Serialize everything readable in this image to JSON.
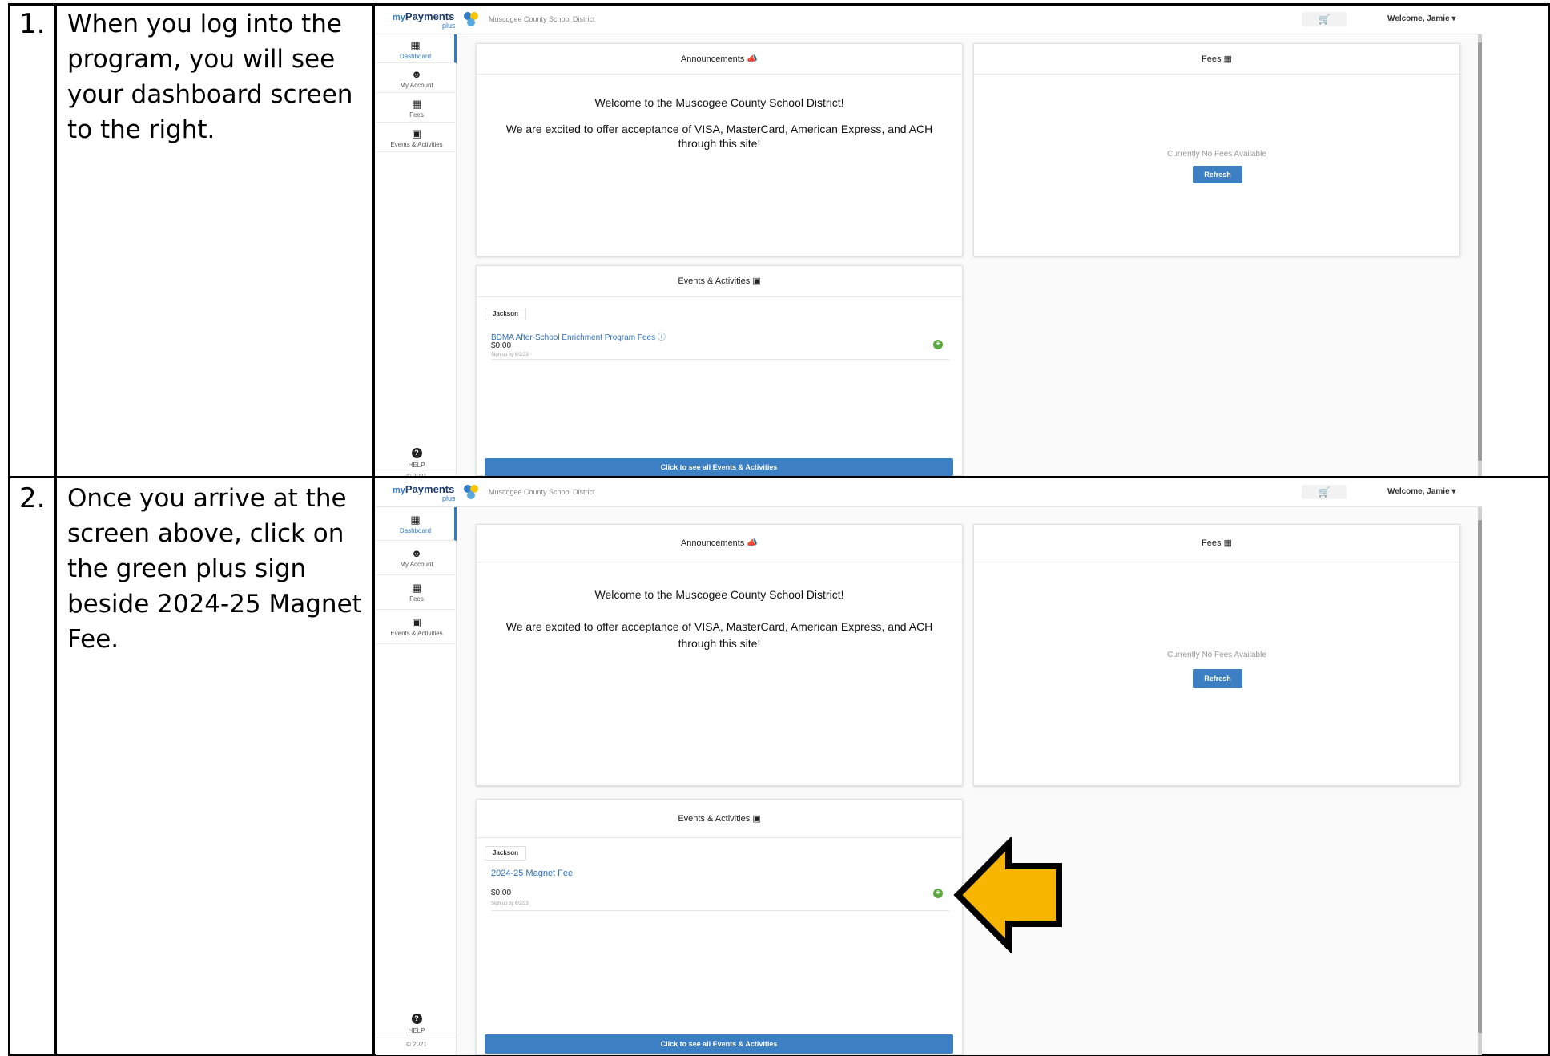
{
  "steps": [
    {
      "number": "1.",
      "text": "When you log into the program, you will see your dashboard screen to the right."
    },
    {
      "number": "2.",
      "text": "Once you arrive at the screen above, click on the green plus sign beside 2024-25 Magnet Fee."
    }
  ],
  "app": {
    "logo_my": "my",
    "logo_payments": "Payments",
    "logo_plus": "plus",
    "district": "Muscogee County School District",
    "welcome": "Welcome, Jamie ▾",
    "sidebar": [
      {
        "label": "Dashboard",
        "icon": "dashboard-icon"
      },
      {
        "label": "My Account",
        "icon": "user-icon"
      },
      {
        "label": "Fees",
        "icon": "clipboard-icon"
      },
      {
        "label": "Events & Activities",
        "icon": "ticket-icon"
      }
    ],
    "help": "HELP",
    "copyright": "© 2021",
    "announcements_title": "Announcements",
    "announcement_line1": "Welcome to the Muscogee County School District!",
    "announcement_line2": "We are excited to offer acceptance of VISA, MasterCard, American Express, and ACH through this site!",
    "fees_title": "Fees",
    "no_fees": "Currently No Fees Available",
    "refresh": "Refresh",
    "events_title": "Events & Activities",
    "student": "Jackson",
    "sign_up_by": "Sign up by 6/2/23",
    "see_all": "Click to see all Events & Activities"
  },
  "shot1": {
    "event_name": "BDMA After-School Enrichment Program Fees",
    "event_price": "$0.00"
  },
  "shot2": {
    "event_name": "2024-25 Magnet Fee",
    "event_price": "$0.00"
  },
  "colors": {
    "accent": "#3c7fc2",
    "plus": "#5aa840",
    "arrow": "#f7b500"
  }
}
